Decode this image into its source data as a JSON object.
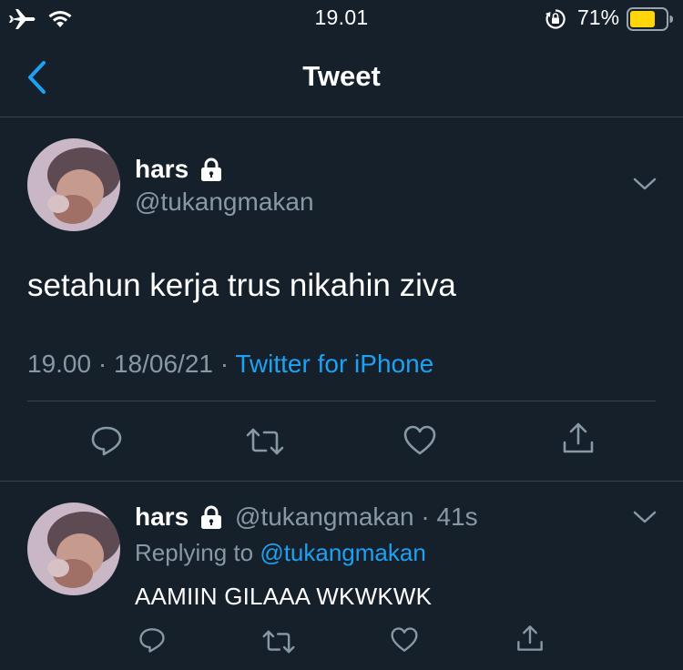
{
  "status_bar": {
    "time": "19.01",
    "battery_percent": "71%",
    "battery_level": 0.71,
    "icons": [
      "airplane-icon",
      "wifi-icon",
      "rotation-lock-icon",
      "battery-icon"
    ]
  },
  "nav": {
    "title": "Tweet",
    "back_icon": "chevron-left-icon"
  },
  "tweet": {
    "author_name": "hars",
    "author_handle": "@tukangmakan",
    "locked": true,
    "text": "setahun kerja trus nikahin ziva",
    "time": "19.00",
    "date": "18/06/21",
    "separator": "·",
    "source": "Twitter for iPhone",
    "actions": [
      "reply-icon",
      "retweet-icon",
      "like-icon",
      "share-icon"
    ]
  },
  "reply": {
    "author_name": "hars",
    "author_handle": "@tukangmakan",
    "age": "41s",
    "separator": "·",
    "replying_prefix": "Replying to",
    "replying_to": "@tukangmakan",
    "text": "AAMIIN GILAAA WKWKWK",
    "actions": [
      "reply-icon",
      "retweet-icon",
      "like-icon",
      "share-icon"
    ]
  },
  "colors": {
    "background": "#15202b",
    "divider": "#38444d",
    "secondary_text": "#8899a6",
    "accent": "#1da1f2",
    "battery": "#ffd60a"
  }
}
